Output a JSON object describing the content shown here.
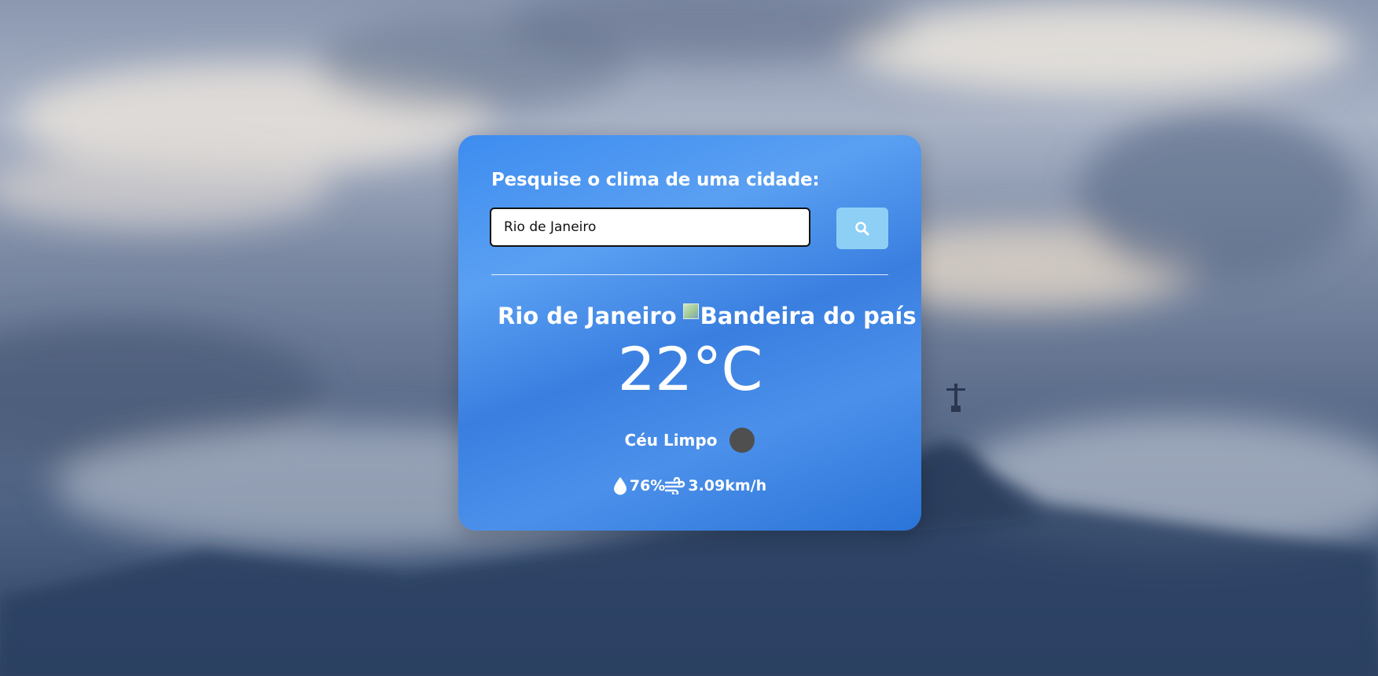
{
  "search": {
    "title": "Pesquise o clima de uma cidade:",
    "value": "Rio de Janeiro"
  },
  "weather": {
    "city": "Rio de Janeiro",
    "flag_alt": "Bandeira do país",
    "temperature": "22°C",
    "description": "Céu Limpo",
    "humidity": "76%",
    "wind": "3.09km/h"
  },
  "icons": {
    "search": "search-icon",
    "location": "map-pin-icon",
    "humidity": "water-drop-icon",
    "wind": "wind-icon",
    "weather": "weather-condition-icon"
  },
  "colors": {
    "card": "#3d8cf0",
    "button": "#8ecff5",
    "text": "#ffffff"
  }
}
